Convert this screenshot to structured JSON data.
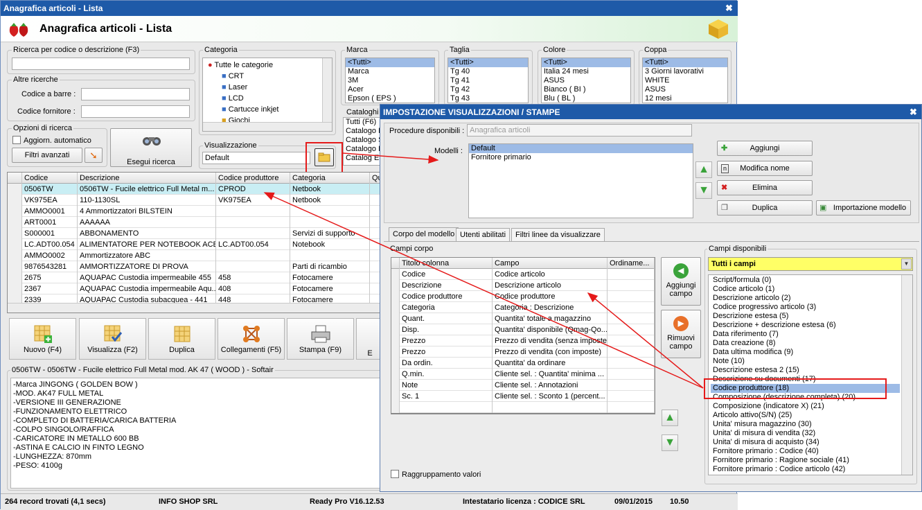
{
  "main": {
    "title": "Anagrafica articoli  - Lista",
    "header": "Anagrafica articoli  - Lista",
    "close_glyph": "✖",
    "search": {
      "label": "Ricerca per codice o descrizione (F3)",
      "value": ""
    },
    "altre": {
      "label": "Altre ricerche",
      "barcode_label": "Codice a barre :",
      "supplier_label": "Codice fornitore :"
    },
    "options": {
      "label": "Opzioni di ricerca",
      "auto_label": "Aggiorn. automatico",
      "filters_label": "Filtri avanzati",
      "execute_label": "Esegui ricerca"
    },
    "categoria": {
      "label": "Categoria",
      "items": [
        "Tutte le categorie",
        "CRT",
        "Laser",
        "LCD",
        "Cartucce inkjet",
        "Giochi"
      ]
    },
    "visualizzazione": {
      "label": "Visualizzazione",
      "value": "Default"
    },
    "marca": {
      "label": "Marca",
      "items": [
        "<Tutti>",
        "Marca",
        "3M",
        "Acer",
        "Epson ( EPS )"
      ]
    },
    "taglia": {
      "label": "Taglia",
      "items": [
        "<Tutti>",
        "Tg 40",
        "Tg 41",
        "Tg 42",
        "Tg 43"
      ]
    },
    "colore": {
      "label": "Colore",
      "items": [
        "<Tutti>",
        "Italia 24 mesi",
        "ASUS",
        "Bianco ( BI )",
        "Blu ( BL )"
      ]
    },
    "coppa": {
      "label": "Coppa",
      "items": [
        "<Tutti>",
        "3 Giorni lavorativi",
        "WHITE",
        "ASUS",
        "12 mesi"
      ]
    },
    "cataloghi": {
      "label": "Cataloghi",
      "items": [
        "Tutti (F6)",
        "Catalogo P",
        "Catalogo S",
        "Catalogo RI",
        "Catalog ES"
      ]
    },
    "grid": {
      "headers": [
        "Codice",
        "Descrizione",
        "Codice produttore",
        "Categoria",
        "Qu"
      ],
      "rows": [
        [
          "0506TW",
          "0506TW  - Fucile elettrico Full Metal m...",
          "CPROD",
          "Netbook"
        ],
        [
          "VK975EA",
          "110-1130SL",
          "VK975EA",
          "Netbook"
        ],
        [
          "AMMO0001",
          "4 Ammortizzatori BILSTEIN",
          "",
          ""
        ],
        [
          "ART0001",
          "AAAAAA",
          "",
          ""
        ],
        [
          "S000001",
          "ABBONAMENTO",
          "",
          "Servizi di supporto"
        ],
        [
          "LC.ADT00.054",
          "ALIMENTATORE PER NOTEBOOK ACER",
          "LC.ADT00.054",
          "Notebook"
        ],
        [
          "AMMO0002",
          "Ammortizzatore ABC",
          "",
          ""
        ],
        [
          "9876543281",
          "AMMORTIZZATORE DI PROVA",
          "",
          "Parti di ricambio"
        ],
        [
          "2675",
          "AQUAPAC Custodia impermeabile 455",
          "458",
          "Fotocamere"
        ],
        [
          "2367",
          "AQUAPAC Custodia impermeabile Aqu...",
          "408",
          "Fotocamere"
        ],
        [
          "2339",
          "AQUAPAC Custodia subacquea - 441",
          "448",
          "Fotocamere"
        ]
      ]
    },
    "toolbar": {
      "nuovo": "Nuovo (F4)",
      "visualizza": "Visualizza (F2)",
      "duplica": "Duplica",
      "collegamenti": "Collegamenti (F5)",
      "stampa": "Stampa (F9)",
      "e": "E"
    },
    "detail": {
      "title": "0506TW - 0506TW  - Fucile elettrico Full Metal mod. AK 47 ( WOOD ) - Softair",
      "lines": [
        "-Marca JINGONG ( GOLDEN BOW )",
        "-MOD. AK47 FULL METAL",
        "-VERSIONE III GENERAZIONE",
        "-FUNZIONAMENTO ELETTRICO",
        "-COMPLETO DI BATTERIA/CARICA BATTERIA",
        "-COLPO SINGOLO/RAFFICA",
        "-CARICATORE IN METALLO 600 BB",
        "-ASTINA E CALCIO IN FINTO LEGNO",
        "-LUNGHEZZA: 870mm",
        "-PESO: 4100g"
      ]
    },
    "status": {
      "records": "264 record trovati (4,1 secs)",
      "company": "INFO SHOP SRL",
      "version": "Ready Pro V16.12.53",
      "license": "Intestatario licenza : CODICE SRL",
      "date": "09/01/2015",
      "time": "10.50"
    }
  },
  "dialog": {
    "title": "IMPOSTAZIONE VISUALIZZAZIONI / STAMPE",
    "procedure_label": "Procedure disponibili :",
    "procedure_value": "Anagrafica articoli",
    "modelli_label": "Modelli :",
    "modelli": [
      "Default",
      "Fornitore primario"
    ],
    "buttons": {
      "aggiungi": "Aggiungi",
      "modifica": "Modifica nome",
      "elimina": "Elimina",
      "duplica": "Duplica",
      "importazione": "Importazione modello"
    },
    "tabs": [
      "Corpo del modello",
      "Utenti abilitati",
      "Filtri linee da visualizzare"
    ],
    "campi_corpo_label": "Campi corpo",
    "corpo_headers": [
      "Titolo colonna",
      "Campo",
      "Ordiname..."
    ],
    "corpo_rows": [
      [
        "Codice",
        "Codice articolo"
      ],
      [
        "Descrizione",
        "Descrizione articolo"
      ],
      [
        "Codice produttore",
        "Codice produttore"
      ],
      [
        "Categoria",
        "Categoria : Descrizione"
      ],
      [
        "Quant.",
        "Quantita' totale a magazzino"
      ],
      [
        "Disp.",
        "Quantita' disponibile (Qmag-Qo..."
      ],
      [
        "Prezzo",
        "Prezzo di vendita (senza imposte)"
      ],
      [
        "Prezzo",
        "Prezzo di vendita (con imposte)"
      ],
      [
        "Da ordin.",
        "Quantita' da ordinare"
      ],
      [
        "Q.min.",
        "Cliente sel. : Quantita' minima ..."
      ],
      [
        "Note",
        "Cliente sel. : Annotazioni"
      ],
      [
        "Sc. 1",
        "Cliente sel. : Sconto 1 (percent..."
      ]
    ],
    "aggiungi_campo": "Aggiungi campo",
    "rimuovi_campo": "Rimuovi campo",
    "raggruppamento": "Raggruppamento valori",
    "campi_disponibili_label": "Campi disponibili",
    "campi_filter": "Tutti i campi",
    "campi": [
      "Script/formula (0)",
      "Codice articolo (1)",
      "Descrizione articolo (2)",
      "Codice progressivo articolo (3)",
      "Descrizione estesa (5)",
      "Descrizione + descrizione estesa (6)",
      "Data riferimento (7)",
      "Data creazione (8)",
      "Data ultima modifica (9)",
      "Note (10)",
      "Descrizione estesa 2 (15)",
      "Descrizione su documenti (17)",
      "Codice produttore (18)",
      "Composizione (descrizione completa) (20)",
      "Composizione (indicatore X) (21)",
      "Articolo attivo(S/N) (25)",
      "Unita' misura magazzino (30)",
      "Unita' di misura di vendita (32)",
      "Unita' di misura di acquisto (34)",
      "Fornitore primario : Codice (40)",
      "Fornitore primario : Ragione sociale (41)",
      "Fornitore primario : Codice articolo (42)"
    ]
  },
  "colors": {
    "titlebar": "#1e5aa8",
    "selection": "#9dbbe6",
    "highlight_red": "#e51a1a",
    "filter_yellow": "#ffff66"
  }
}
